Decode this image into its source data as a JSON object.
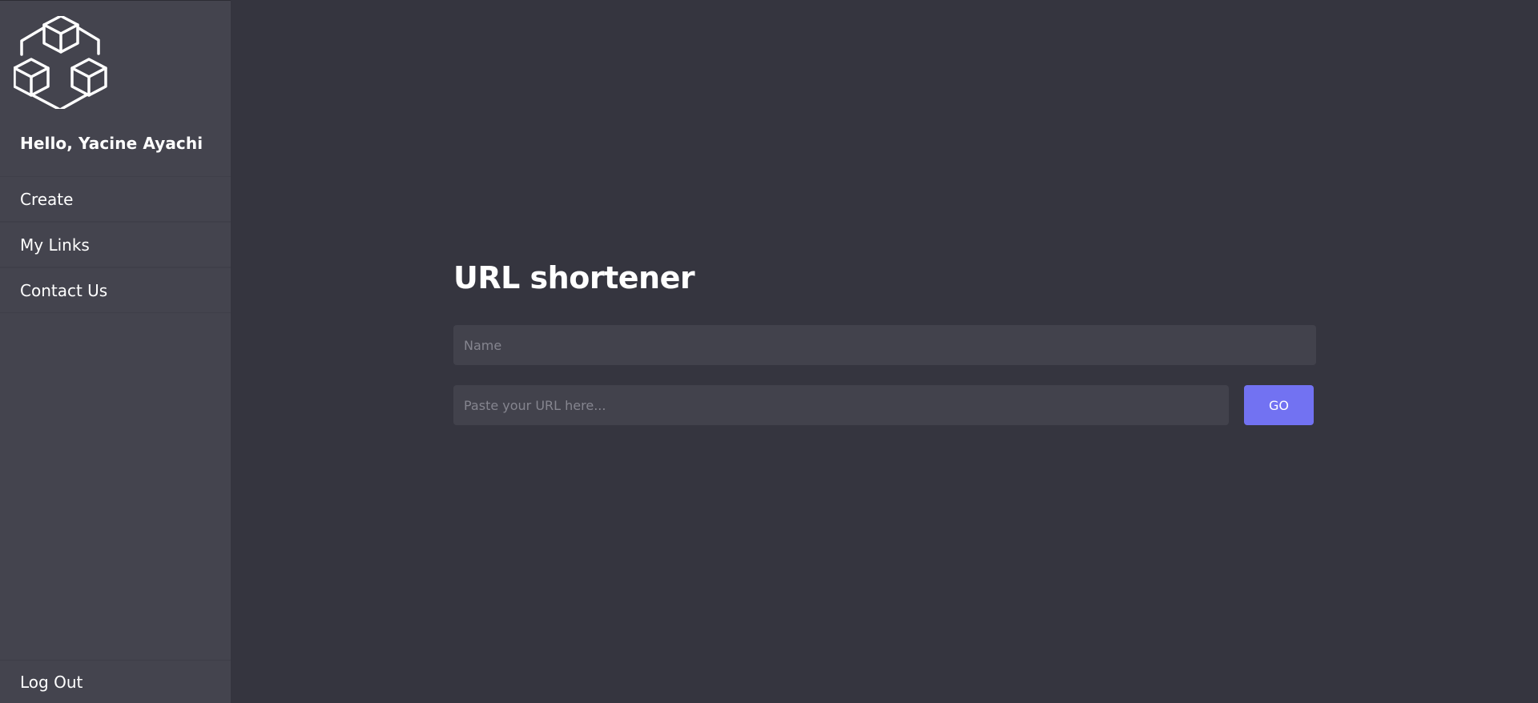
{
  "sidebar": {
    "logo_icon": "cubes-network-icon",
    "greeting": "Hello, Yacine Ayachi",
    "nav_items": [
      {
        "label": "Create"
      },
      {
        "label": "My Links"
      },
      {
        "label": "Contact Us"
      }
    ],
    "logout_label": "Log Out"
  },
  "main": {
    "title": "URL shortener",
    "name_placeholder": "Name",
    "url_placeholder": "Paste your URL here...",
    "go_label": "GO"
  },
  "colors": {
    "background": "#35353f",
    "sidebar": "#44444e",
    "input": "#42424c",
    "accent": "#7272f2"
  }
}
